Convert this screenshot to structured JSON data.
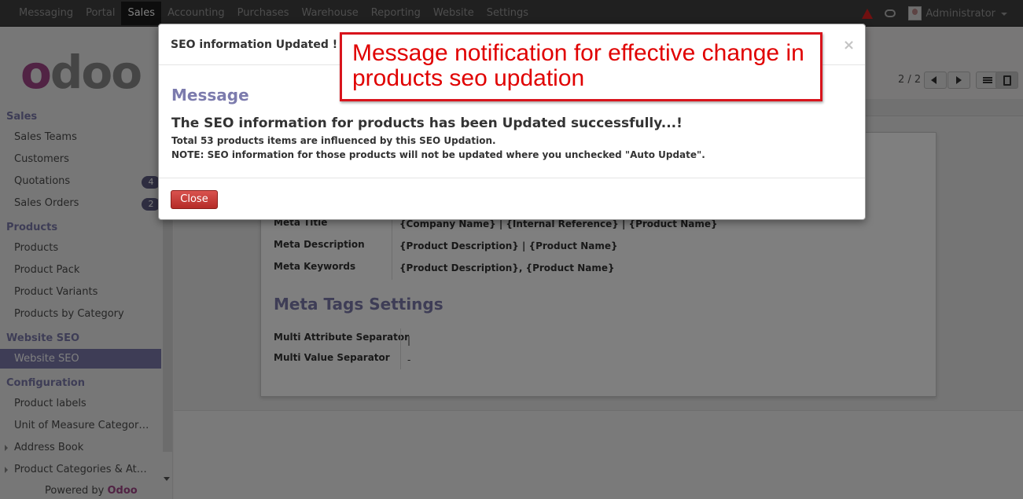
{
  "topbar": {
    "menu": [
      "Messaging",
      "Portal",
      "Sales",
      "Accounting",
      "Purchases",
      "Warehouse",
      "Reporting",
      "Website",
      "Settings"
    ],
    "active": "Sales",
    "user": "Administrator",
    "icons": [
      "warning-icon",
      "chat-icon",
      "avatar"
    ]
  },
  "logo": {
    "text": "odoo"
  },
  "sidebar": {
    "sections": [
      {
        "title": "Sales",
        "items": [
          {
            "label": "Sales Teams"
          },
          {
            "label": "Customers"
          },
          {
            "label": "Quotations",
            "badge": "4"
          },
          {
            "label": "Sales Orders",
            "badge": "2"
          }
        ]
      },
      {
        "title": "Products",
        "items": [
          {
            "label": "Products"
          },
          {
            "label": "Product Pack"
          },
          {
            "label": "Product Variants"
          },
          {
            "label": "Products by Category"
          }
        ]
      },
      {
        "title": "Website SEO",
        "items": [
          {
            "label": "Website SEO",
            "active": true
          }
        ]
      },
      {
        "title": "Configuration",
        "items": [
          {
            "label": "Product labels"
          },
          {
            "label": "Unit of Measure Categor…"
          },
          {
            "label": "Address Book"
          },
          {
            "label": "Product Categories & At…"
          }
        ]
      }
    ],
    "powered_prefix": "Powered by",
    "powered_brand": "Odoo"
  },
  "pager": {
    "text": "2 / 2"
  },
  "form": {
    "fields": [
      {
        "label": "Meta Title",
        "value": "{Company Name} | {Internal Reference} | {Product Name}"
      },
      {
        "label": "Meta Description",
        "value": "{Product Description} | {Product Name}"
      },
      {
        "label": "Meta Keywords",
        "value": "{Product Description}, {Product Name}"
      }
    ],
    "meta_tags_heading": "Meta Tags Settings",
    "tag_fields": [
      {
        "label": "Multi Attribute Separator",
        "value": "|"
      },
      {
        "label": "Multi Value Separator",
        "value": "-"
      }
    ]
  },
  "modal": {
    "title": "SEO information Updated !",
    "close_x": "×",
    "heading": "Message",
    "main_text": "The SEO information for products has been Updated successfully...!",
    "line1": "Total 53 products items are influenced by this SEO Updation.",
    "line2": "NOTE: SEO information for those products will not be updated where you unchecked \"Auto Update\".",
    "close_button": "Close"
  },
  "callout": {
    "text": "Message notification for effective change in products seo updation"
  },
  "colors": {
    "accent": "#7c7bad",
    "brand": "#a24689",
    "danger": "#d9534f",
    "callout": "#e00000"
  }
}
